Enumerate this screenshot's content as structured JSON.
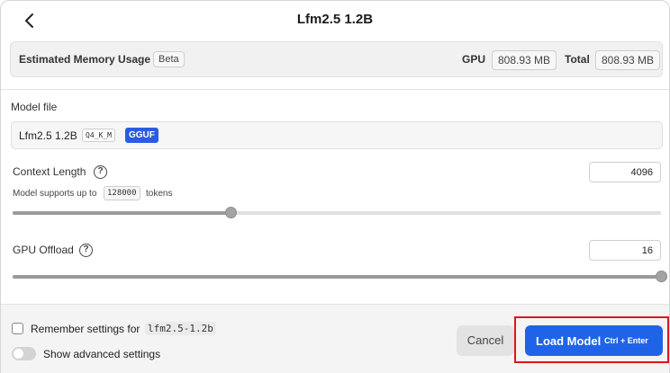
{
  "header": {
    "title": "Lfm2.5 1.2B",
    "back_icon": "chevron-left-icon"
  },
  "memory": {
    "label": "Estimated Memory Usage",
    "beta": "Beta",
    "gpu_label": "GPU",
    "gpu_value": "808.93 MB",
    "total_label": "Total",
    "total_value": "808.93 MB"
  },
  "model_file": {
    "label": "Model file",
    "name": "Lfm2.5 1.2B",
    "quant": "Q4_K_M",
    "format": "GGUF"
  },
  "context_length": {
    "label": "Context Length",
    "help_icon": "question-circle-icon",
    "value": "4096",
    "support_prefix": "Model supports up to",
    "support_value": "128000",
    "support_suffix": "tokens",
    "slider_fraction": 0.336
  },
  "gpu_offload": {
    "label": "GPU Offload",
    "help_icon": "question-circle-icon",
    "value": "16",
    "slider_fraction": 1.0
  },
  "footer": {
    "remember_label": "Remember settings for",
    "remember_code": "lfm2.5-1.2b",
    "remember_checked": false,
    "advanced_label": "Show advanced settings",
    "advanced_on": false,
    "cancel_label": "Cancel",
    "load_label": "Load Model",
    "load_shortcut": "Ctrl + Enter"
  },
  "colors": {
    "primary": "#1f64e8",
    "format_tag": "#2a5ce0",
    "highlight": "#e0141e"
  }
}
